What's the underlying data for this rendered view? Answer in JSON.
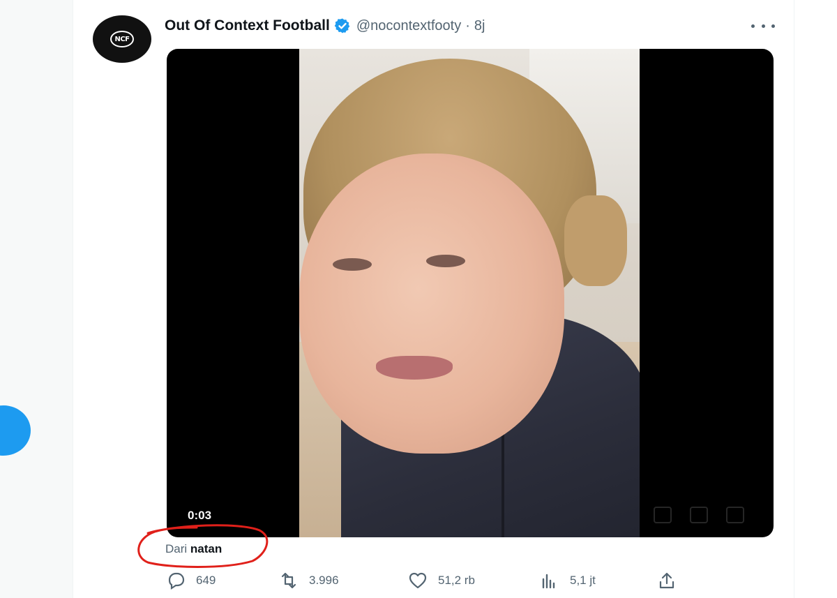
{
  "tweet": {
    "display_name": "Out Of Context Football",
    "handle": "@nocontextfooty",
    "separator": "·",
    "time": "8j",
    "avatar_logo": "NCF",
    "video": {
      "timestamp": "0:03"
    },
    "caption": {
      "prefix": "Dari",
      "name": "natan"
    },
    "actions": {
      "replies": "649",
      "retweets": "3.996",
      "likes": "51,2 rb",
      "views": "5,1 jt"
    },
    "icons": {
      "verified": "verified-badge-icon",
      "more": "more-dots-icon",
      "reply": "reply-icon",
      "retweet": "retweet-icon",
      "like": "heart-icon",
      "views": "views-chart-icon",
      "share": "share-icon"
    }
  },
  "colors": {
    "accent": "#1d9bf0",
    "secondary_text": "#536471",
    "primary_text": "#0f1419",
    "annotation": "#e0201a"
  }
}
